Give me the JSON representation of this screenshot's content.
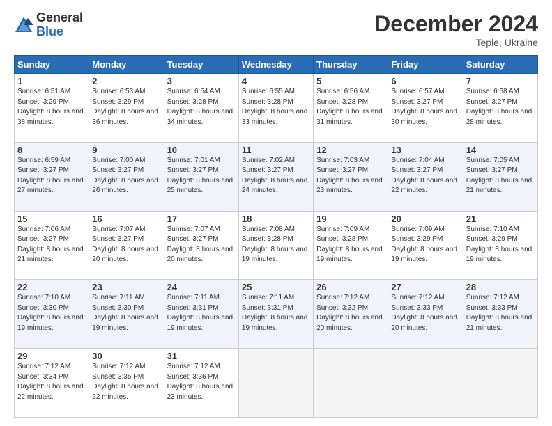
{
  "header": {
    "logo_general": "General",
    "logo_blue": "Blue",
    "month_title": "December 2024",
    "location": "Teple, Ukraine"
  },
  "weekdays": [
    "Sunday",
    "Monday",
    "Tuesday",
    "Wednesday",
    "Thursday",
    "Friday",
    "Saturday"
  ],
  "weeks": [
    [
      {
        "day": 1,
        "sunrise": "6:51 AM",
        "sunset": "3:29 PM",
        "daylight": "8 hours and 38 minutes."
      },
      {
        "day": 2,
        "sunrise": "6:53 AM",
        "sunset": "3:29 PM",
        "daylight": "8 hours and 36 minutes."
      },
      {
        "day": 3,
        "sunrise": "6:54 AM",
        "sunset": "3:28 PM",
        "daylight": "8 hours and 34 minutes."
      },
      {
        "day": 4,
        "sunrise": "6:55 AM",
        "sunset": "3:28 PM",
        "daylight": "8 hours and 33 minutes."
      },
      {
        "day": 5,
        "sunrise": "6:56 AM",
        "sunset": "3:28 PM",
        "daylight": "8 hours and 31 minutes."
      },
      {
        "day": 6,
        "sunrise": "6:57 AM",
        "sunset": "3:27 PM",
        "daylight": "8 hours and 30 minutes."
      },
      {
        "day": 7,
        "sunrise": "6:58 AM",
        "sunset": "3:27 PM",
        "daylight": "8 hours and 28 minutes."
      }
    ],
    [
      {
        "day": 8,
        "sunrise": "6:59 AM",
        "sunset": "3:27 PM",
        "daylight": "8 hours and 27 minutes."
      },
      {
        "day": 9,
        "sunrise": "7:00 AM",
        "sunset": "3:27 PM",
        "daylight": "8 hours and 26 minutes."
      },
      {
        "day": 10,
        "sunrise": "7:01 AM",
        "sunset": "3:27 PM",
        "daylight": "8 hours and 25 minutes."
      },
      {
        "day": 11,
        "sunrise": "7:02 AM",
        "sunset": "3:27 PM",
        "daylight": "8 hours and 24 minutes."
      },
      {
        "day": 12,
        "sunrise": "7:03 AM",
        "sunset": "3:27 PM",
        "daylight": "8 hours and 23 minutes."
      },
      {
        "day": 13,
        "sunrise": "7:04 AM",
        "sunset": "3:27 PM",
        "daylight": "8 hours and 22 minutes."
      },
      {
        "day": 14,
        "sunrise": "7:05 AM",
        "sunset": "3:27 PM",
        "daylight": "8 hours and 21 minutes."
      }
    ],
    [
      {
        "day": 15,
        "sunrise": "7:06 AM",
        "sunset": "3:27 PM",
        "daylight": "8 hours and 21 minutes."
      },
      {
        "day": 16,
        "sunrise": "7:07 AM",
        "sunset": "3:27 PM",
        "daylight": "8 hours and 20 minutes."
      },
      {
        "day": 17,
        "sunrise": "7:07 AM",
        "sunset": "3:27 PM",
        "daylight": "8 hours and 20 minutes."
      },
      {
        "day": 18,
        "sunrise": "7:08 AM",
        "sunset": "3:28 PM",
        "daylight": "8 hours and 19 minutes."
      },
      {
        "day": 19,
        "sunrise": "7:09 AM",
        "sunset": "3:28 PM",
        "daylight": "8 hours and 19 minutes."
      },
      {
        "day": 20,
        "sunrise": "7:09 AM",
        "sunset": "3:29 PM",
        "daylight": "8 hours and 19 minutes."
      },
      {
        "day": 21,
        "sunrise": "7:10 AM",
        "sunset": "3:29 PM",
        "daylight": "8 hours and 19 minutes."
      }
    ],
    [
      {
        "day": 22,
        "sunrise": "7:10 AM",
        "sunset": "3:30 PM",
        "daylight": "8 hours and 19 minutes."
      },
      {
        "day": 23,
        "sunrise": "7:11 AM",
        "sunset": "3:30 PM",
        "daylight": "8 hours and 19 minutes."
      },
      {
        "day": 24,
        "sunrise": "7:11 AM",
        "sunset": "3:31 PM",
        "daylight": "8 hours and 19 minutes."
      },
      {
        "day": 25,
        "sunrise": "7:11 AM",
        "sunset": "3:31 PM",
        "daylight": "8 hours and 19 minutes."
      },
      {
        "day": 26,
        "sunrise": "7:12 AM",
        "sunset": "3:32 PM",
        "daylight": "8 hours and 20 minutes."
      },
      {
        "day": 27,
        "sunrise": "7:12 AM",
        "sunset": "3:33 PM",
        "daylight": "8 hours and 20 minutes."
      },
      {
        "day": 28,
        "sunrise": "7:12 AM",
        "sunset": "3:33 PM",
        "daylight": "8 hours and 21 minutes."
      }
    ],
    [
      {
        "day": 29,
        "sunrise": "7:12 AM",
        "sunset": "3:34 PM",
        "daylight": "8 hours and 22 minutes."
      },
      {
        "day": 30,
        "sunrise": "7:12 AM",
        "sunset": "3:35 PM",
        "daylight": "8 hours and 22 minutes."
      },
      {
        "day": 31,
        "sunrise": "7:12 AM",
        "sunset": "3:36 PM",
        "daylight": "8 hours and 23 minutes."
      },
      null,
      null,
      null,
      null
    ]
  ]
}
